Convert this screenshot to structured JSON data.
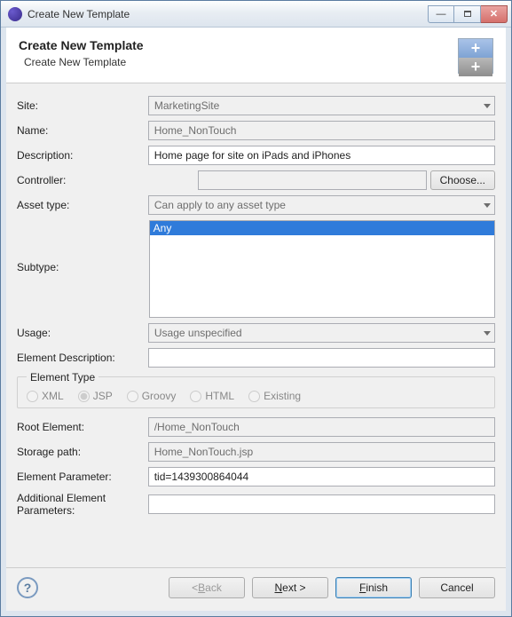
{
  "window": {
    "title": "Create New Template"
  },
  "header": {
    "title": "Create New Template",
    "subtitle": "Create New Template"
  },
  "form": {
    "site": {
      "label": "Site:",
      "value": "MarketingSite"
    },
    "name": {
      "label": "Name:",
      "value": "Home_NonTouch"
    },
    "description": {
      "label": "Description:",
      "value": "Home page for site on iPads and iPhones"
    },
    "controller": {
      "label": "Controller:",
      "value": "",
      "choose": "Choose..."
    },
    "assetType": {
      "label": "Asset type:",
      "value": "Can apply to any asset type"
    },
    "subtype": {
      "label": "Subtype:",
      "items": [
        "Any"
      ]
    },
    "usage": {
      "label": "Usage:",
      "value": "Usage unspecified"
    },
    "elementDescription": {
      "label": "Element Description:",
      "value": ""
    },
    "elementType": {
      "legend": "Element Type",
      "options": [
        "XML",
        "JSP",
        "Groovy",
        "HTML",
        "Existing"
      ],
      "selected": "JSP"
    },
    "rootElement": {
      "label": "Root Element:",
      "value": "/Home_NonTouch"
    },
    "storagePath": {
      "label": "Storage path:",
      "value": "Home_NonTouch.jsp"
    },
    "elementParameter": {
      "label": "Element Parameter:",
      "value": "tid=1439300864044"
    },
    "additionalParams": {
      "label": "Additional Element Parameters:",
      "value": ""
    }
  },
  "footer": {
    "back": "< Back",
    "next": "Next >",
    "finish": "Finish",
    "cancel": "Cancel"
  }
}
